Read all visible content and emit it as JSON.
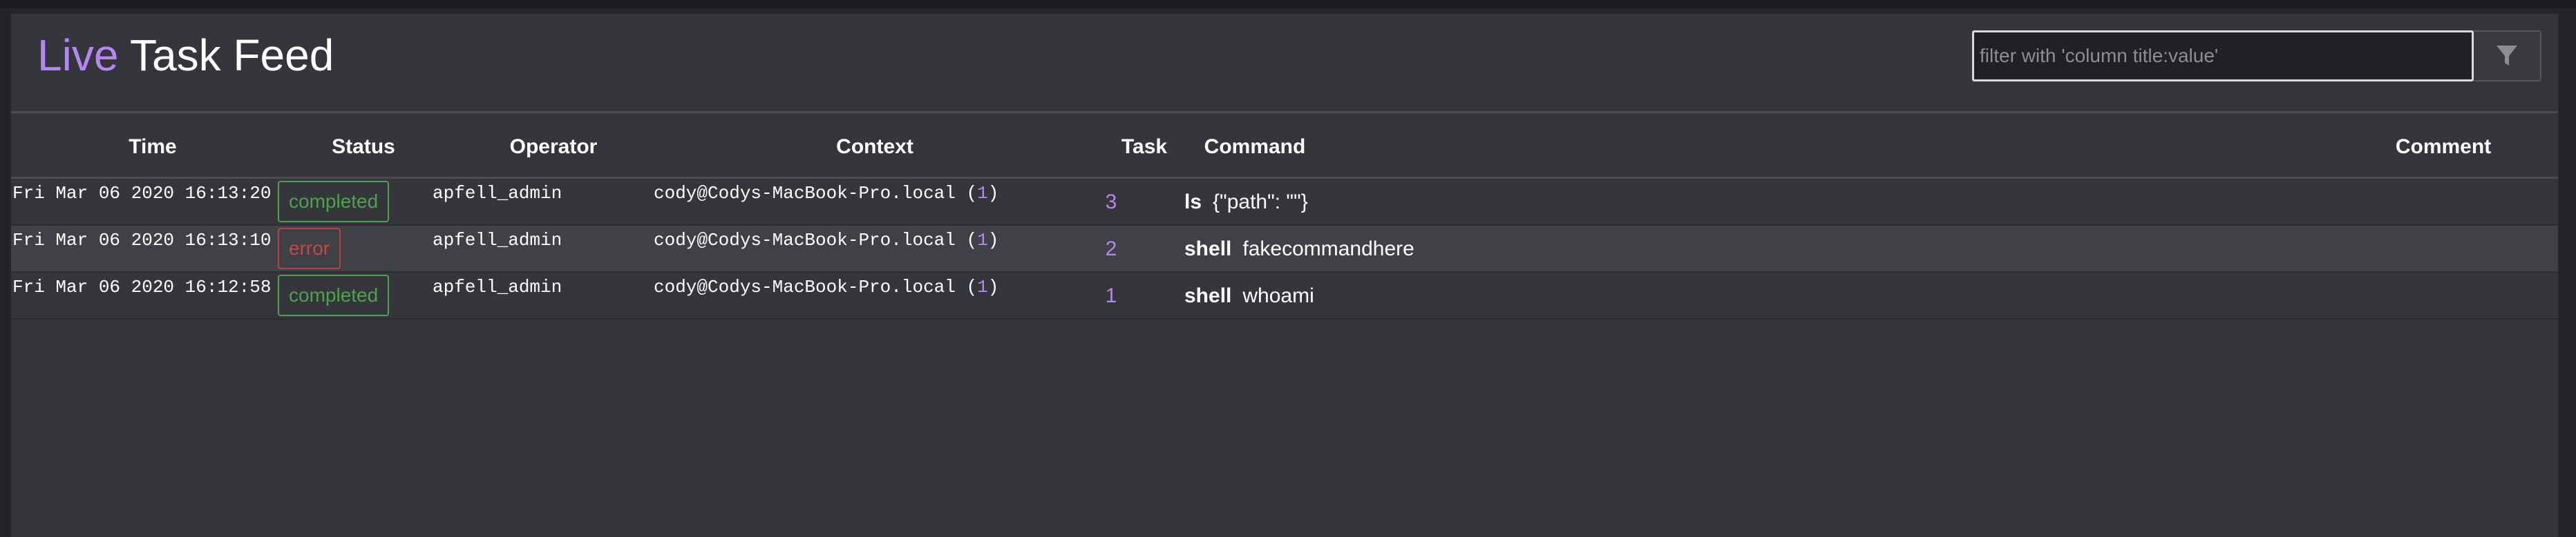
{
  "header": {
    "title_accent": "Live",
    "title_rest": "Task Feed",
    "filter_placeholder": "filter with 'column title:value'",
    "filter_icon": "filter-icon"
  },
  "columns": {
    "time": "Time",
    "status": "Status",
    "operator": "Operator",
    "context": "Context",
    "task": "Task",
    "command": "Command",
    "comment": "Comment"
  },
  "colors": {
    "accent": "#b585f0",
    "completed": "#4ca34c",
    "error": "#c64646",
    "panel": "#35363b"
  },
  "rows": [
    {
      "time": "Fri Mar 06 2020 16:13:20",
      "status": "completed",
      "operator": "apfell_admin",
      "context_host": "cody@Codys-MacBook-Pro.local (",
      "context_callback": "1",
      "context_close": ")",
      "task": "3",
      "command_name": "ls",
      "command_params": "{\"path\": \"\"}",
      "comment": ""
    },
    {
      "time": "Fri Mar 06 2020 16:13:10",
      "status": "error",
      "operator": "apfell_admin",
      "context_host": "cody@Codys-MacBook-Pro.local (",
      "context_callback": "1",
      "context_close": ")",
      "task": "2",
      "command_name": "shell",
      "command_params": "fakecommandhere",
      "comment": ""
    },
    {
      "time": "Fri Mar 06 2020 16:12:58",
      "status": "completed",
      "operator": "apfell_admin",
      "context_host": "cody@Codys-MacBook-Pro.local (",
      "context_callback": "1",
      "context_close": ")",
      "task": "1",
      "command_name": "shell",
      "command_params": "whoami",
      "comment": ""
    }
  ]
}
